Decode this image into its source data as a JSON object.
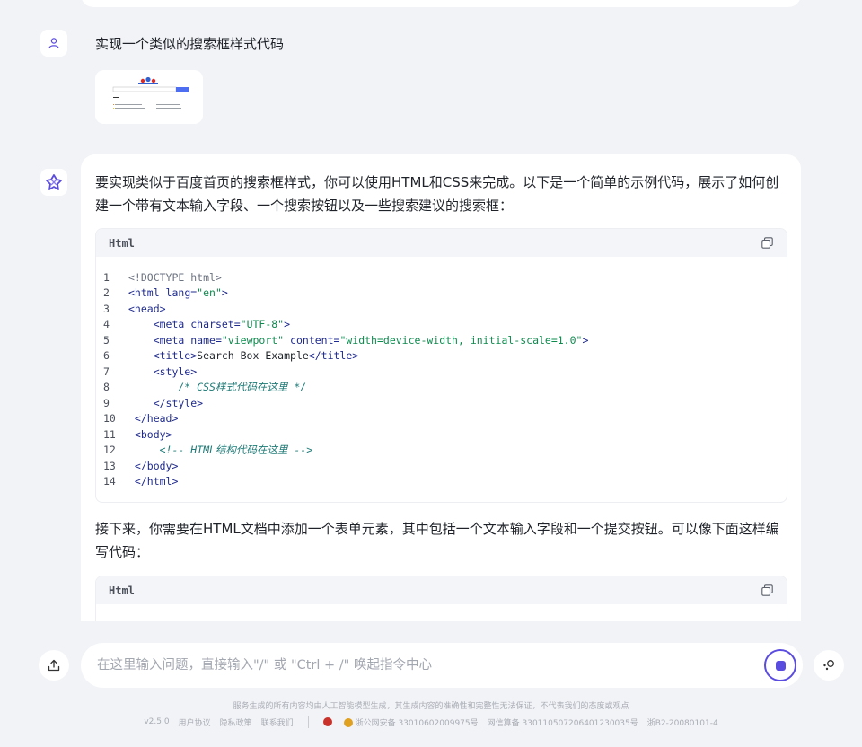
{
  "conversation": {
    "user_question": "实现一个类似的搜索框样式代码",
    "answer_intro": "要实现类似于百度首页的搜索框样式，你可以使用HTML和CSS来完成。以下是一个简单的示例代码，展示了如何创建一个带有文本输入字段、一个搜索按钮以及一些搜索建议的搜索框：",
    "answer_followup": "接下来，你需要在HTML文档中添加一个表单元素，其中包括一个文本输入字段和一个提交按钮。可以像下面这样编写代码：",
    "code_block_1": {
      "lang": "Html",
      "line_numbers": [
        "1",
        "2",
        "3",
        "4",
        "5",
        "6",
        "7",
        "8",
        "9",
        "10",
        "11",
        "12",
        "13",
        "14"
      ]
    },
    "code_block_2": {
      "lang": "Html"
    }
  },
  "input": {
    "placeholder": "在这里输入问题，直接输入\"/\" 或 \"Ctrl + /\" 唤起指令中心"
  },
  "footer": {
    "disclaimer": "服务生成的所有内容均由人工智能模型生成，其生成内容的准确性和完整性无法保证，不代表我们的态度或观点",
    "version": "v2.5.0",
    "user_agreement": "用户协议",
    "privacy_policy": "隐私政策",
    "contact_us": "联系我们",
    "police_record": "浙公网安备 33010602009975号",
    "network_record": "网信算备 330110507206401230035号",
    "icp": "浙B2-20080101-4"
  },
  "colors": {
    "accent": "#5b4ce0",
    "background": "#f2f3f7",
    "tag": "#1f2b8e",
    "string": "#0e8a4e",
    "comment": "#1d7a76"
  },
  "icons": [
    "user-icon",
    "ai-logo-icon",
    "copy-icon",
    "upload-icon",
    "stop-icon",
    "tools-icon",
    "police-badge-icon",
    "emblem-icon"
  ]
}
